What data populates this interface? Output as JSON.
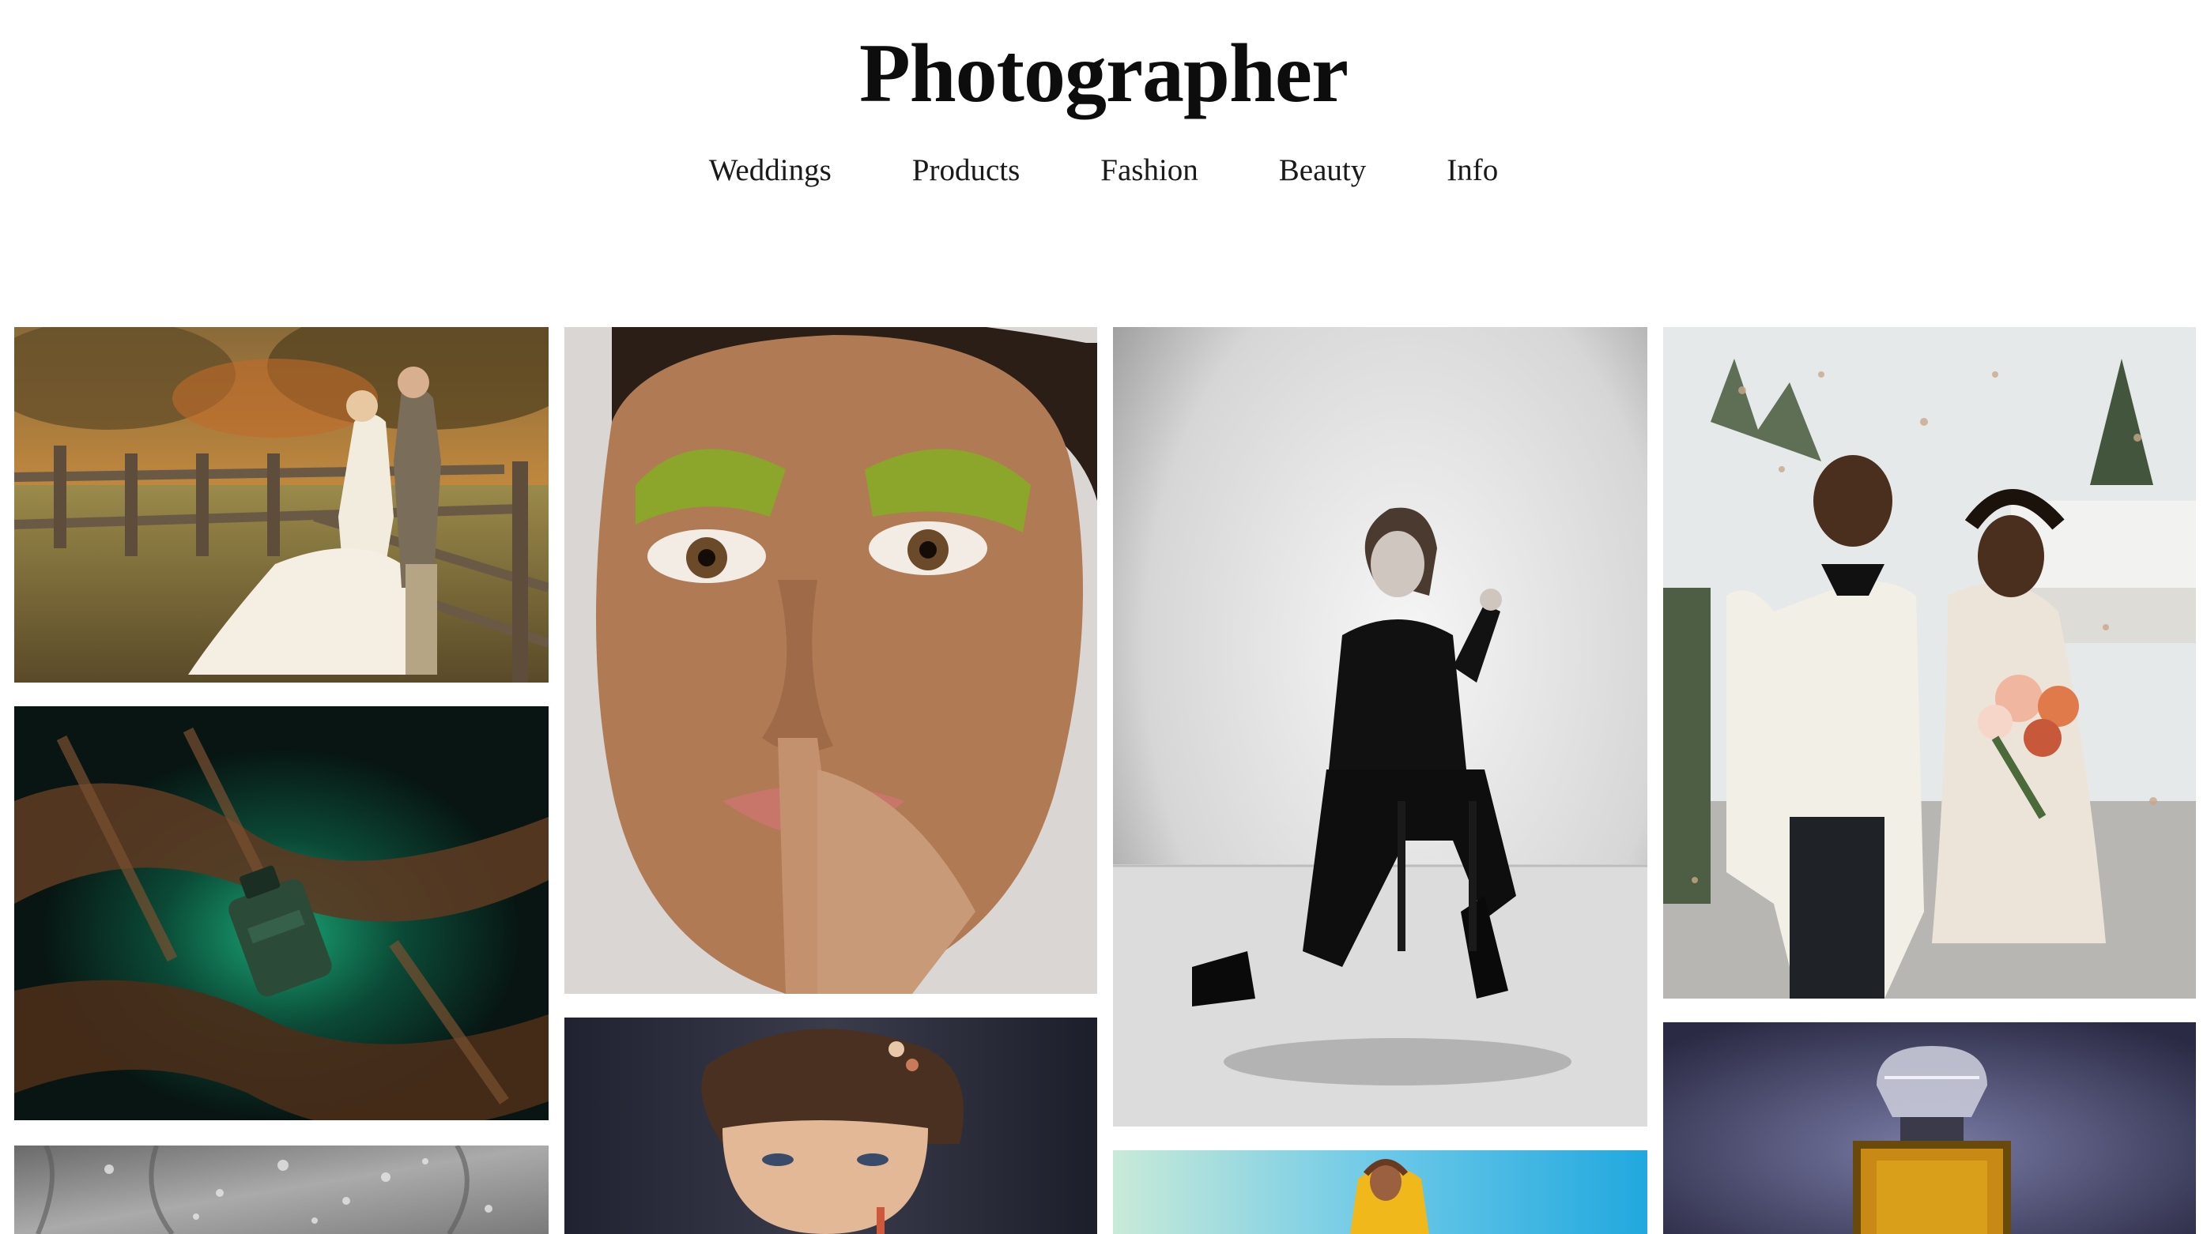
{
  "site": {
    "title": "Photographer"
  },
  "nav": {
    "items": [
      {
        "label": "Weddings"
      },
      {
        "label": "Products"
      },
      {
        "label": "Fashion"
      },
      {
        "label": "Beauty"
      },
      {
        "label": "Info"
      }
    ]
  },
  "gallery": {
    "photos": [
      {
        "subject": "wedding couple by wooden fence at sunset",
        "category": "Weddings"
      },
      {
        "subject": "perfume bottle on tree bark with green light",
        "category": "Products"
      },
      {
        "subject": "water droplets on glass",
        "category": "Products"
      },
      {
        "subject": "beauty close-up with green eyeshadow",
        "category": "Beauty"
      },
      {
        "subject": "portrait with braided hair",
        "category": "Beauty"
      },
      {
        "subject": "black and white seated fashion portrait",
        "category": "Fashion"
      },
      {
        "subject": "model in yellow against blue sky",
        "category": "Fashion"
      },
      {
        "subject": "bride and groom in confetti",
        "category": "Weddings"
      },
      {
        "subject": "perfume bottle on purple backdrop",
        "category": "Products"
      }
    ]
  },
  "colors": {
    "background": "#ffffff",
    "text": "#111111"
  }
}
